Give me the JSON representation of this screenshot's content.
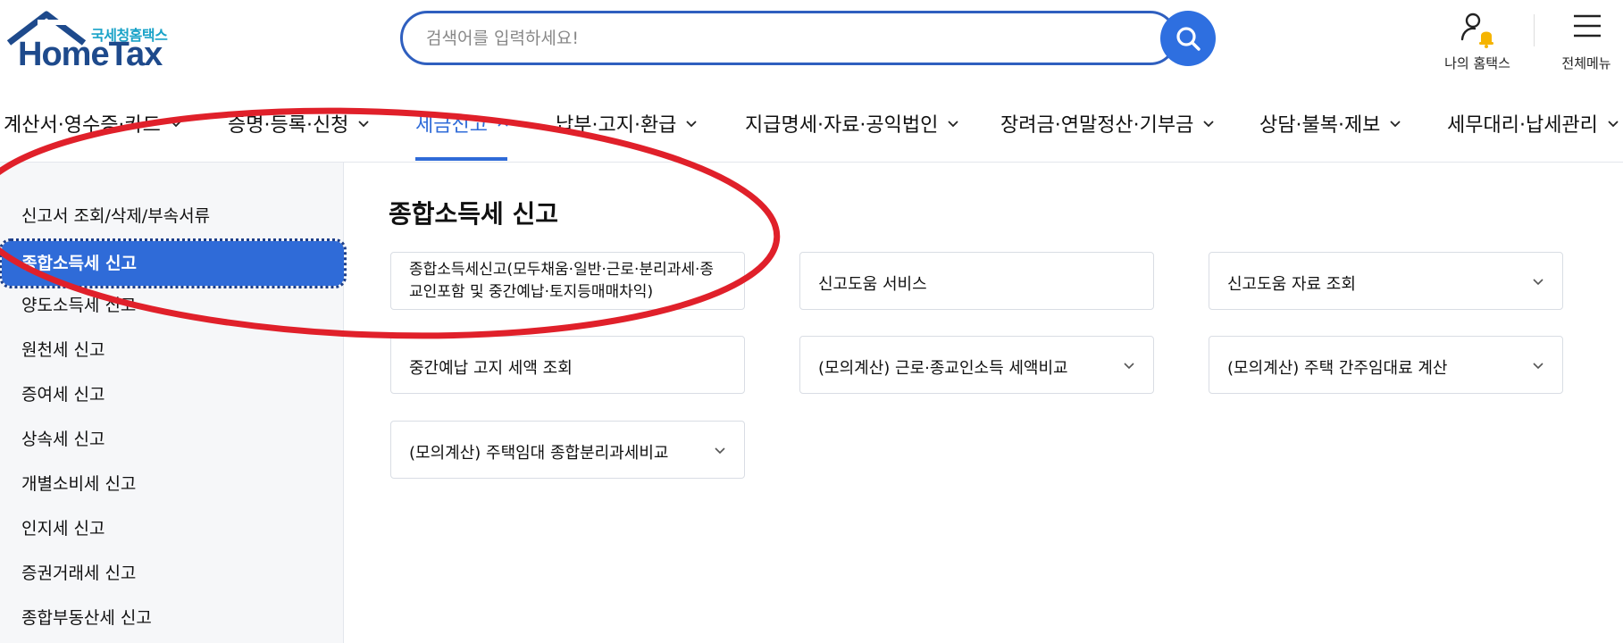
{
  "header": {
    "logo_sub": "국세청홈택스",
    "logo_main": "HomeTax",
    "search_placeholder": "검색어를 입력하세요!",
    "my_hometax_label": "나의 홈택스",
    "all_menu_label": "전체메뉴"
  },
  "gnb": {
    "items": [
      {
        "label": "계산서·영수증·카드"
      },
      {
        "label": "증명·등록·신청"
      },
      {
        "label": "세금신고"
      },
      {
        "label": "납부·고지·환급"
      },
      {
        "label": "지급명세·자료·공익법인"
      },
      {
        "label": "장려금·연말정산·기부금"
      },
      {
        "label": "상담·불복·제보"
      },
      {
        "label": "세무대리·납세관리"
      }
    ],
    "active_index": 2
  },
  "sidebar": {
    "items": [
      {
        "label": "신고서 조회/삭제/부속서류"
      },
      {
        "label": "종합소득세 신고"
      },
      {
        "label": "양도소득세 신고"
      },
      {
        "label": "원천세 신고"
      },
      {
        "label": "증여세 신고"
      },
      {
        "label": "상속세 신고"
      },
      {
        "label": "개별소비세 신고"
      },
      {
        "label": "인지세 신고"
      },
      {
        "label": "증권거래세 신고"
      },
      {
        "label": "종합부동산세 신고"
      }
    ],
    "active_index": 1
  },
  "content": {
    "title": "종합소득세 신고",
    "cards": [
      {
        "label": "종합소득세신고(모두채움·일반·근로·분리과세·종교인포함 및 중간예납·토지등매매차익)"
      },
      {
        "label": "신고도움 서비스"
      },
      {
        "label": "신고도움 자료 조회"
      },
      {
        "label": "중간예납 고지 세액 조회"
      },
      {
        "label": "(모의계산) 근로·종교인소득 세액비교"
      },
      {
        "label": "(모의계산) 주택 간주임대료 계산"
      },
      {
        "label": "(모의계산) 주택임대 종합분리과세비교"
      }
    ]
  },
  "colors": {
    "brand_blue": "#2f6bd8",
    "search_border": "#2f5fbf",
    "logo_blue": "#1e4a8c",
    "logo_teal": "#1aa3c8",
    "annotation_red": "#e0202a"
  }
}
